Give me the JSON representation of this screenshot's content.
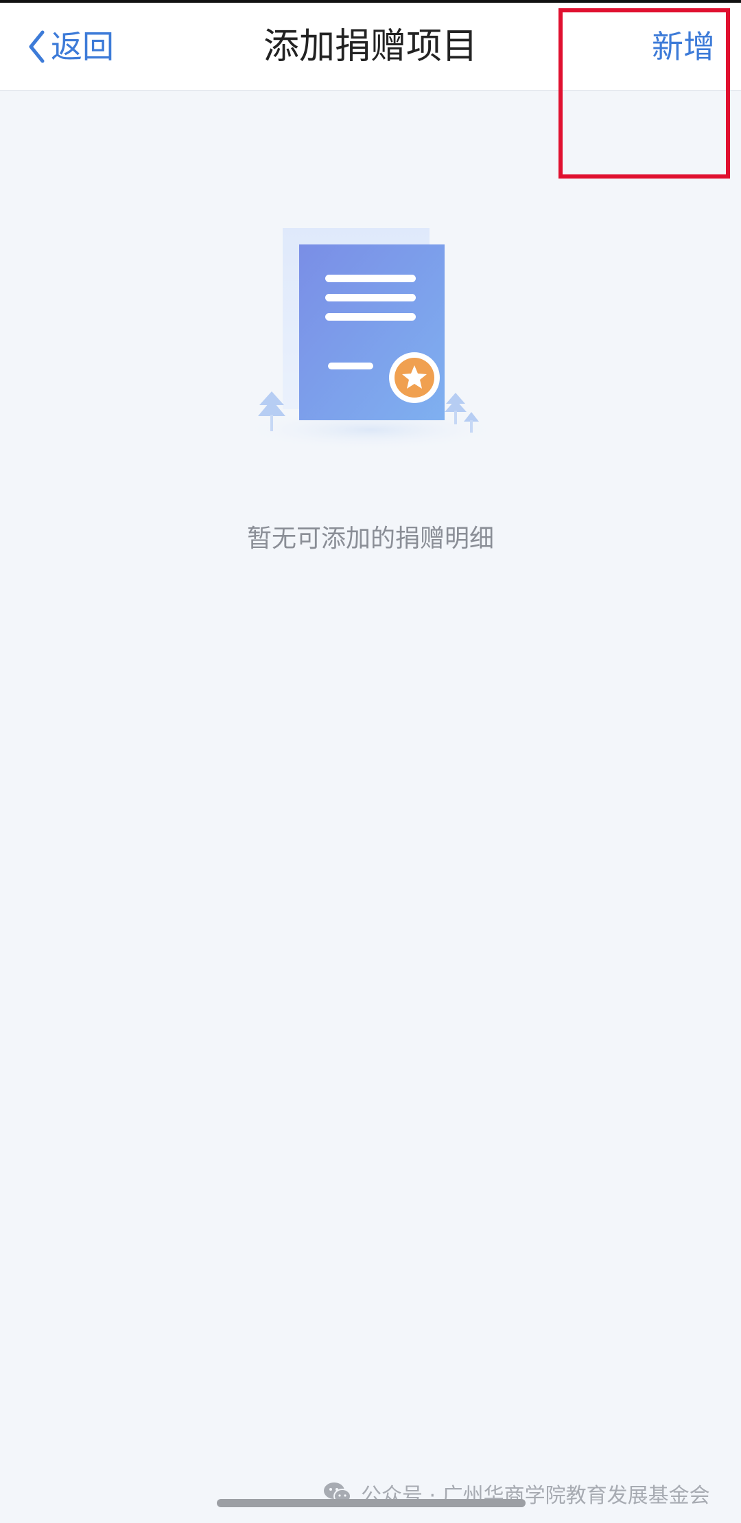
{
  "nav": {
    "back_label": "返回",
    "title": "添加捐赠项目",
    "add_label": "新增"
  },
  "empty_state": {
    "message": "暂无可添加的捐赠明细",
    "illustration": "document-with-star-badge"
  },
  "watermark": {
    "icon": "wechat-icon",
    "text": "公众号 · 广州华商学院教育发展基金会"
  },
  "colors": {
    "accent": "#3d7bd8",
    "background": "#f3f6fa",
    "highlight": "#e0102f",
    "badge": "#f0a050"
  }
}
